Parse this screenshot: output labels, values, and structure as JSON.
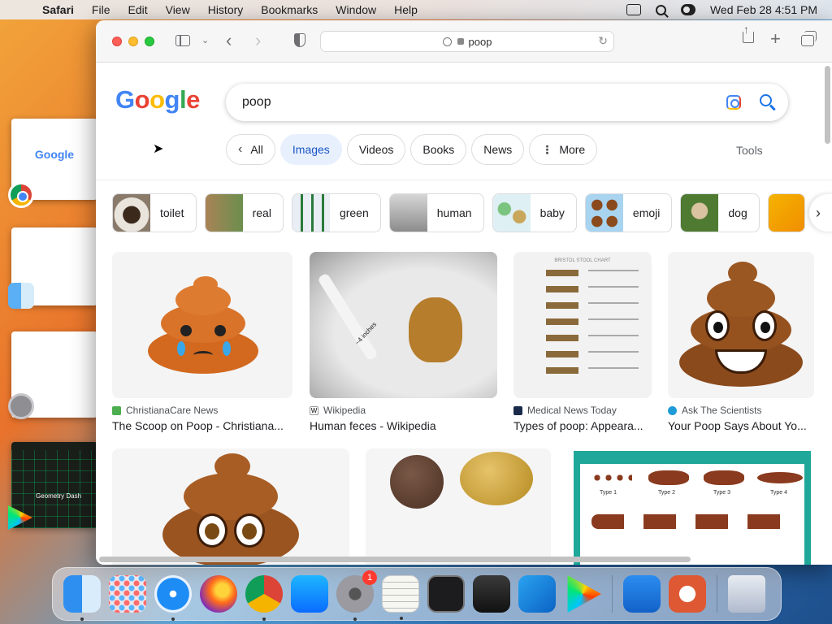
{
  "menubar": {
    "app": "Safari",
    "items": [
      "File",
      "Edit",
      "View",
      "History",
      "Bookmarks",
      "Window",
      "Help"
    ],
    "clock": "Wed Feb 28  4:51 PM"
  },
  "stage": {
    "thumb1_text": "Google",
    "thumb4_text": "Geometry Dash"
  },
  "browser": {
    "url": "poop"
  },
  "google": {
    "query": "poop",
    "tabs": [
      "All",
      "Images",
      "Videos",
      "Books",
      "News",
      "More"
    ],
    "active_tab": "Images",
    "tools": "Tools",
    "related": [
      "toilet",
      "real",
      "green",
      "human",
      "baby",
      "emoji",
      "dog"
    ],
    "results": [
      {
        "source": "ChristianaCare News",
        "title": "The Scoop on Poop - Christiana..."
      },
      {
        "source": "Wikipedia",
        "title": "Human feces - Wikipedia"
      },
      {
        "source": "Medical News Today",
        "title": "Types of poop: Appeara..."
      },
      {
        "source": "Ask The Scientists",
        "title": "Your Poop Says About Yo..."
      }
    ],
    "chart_labels": [
      "Type 1",
      "Type 2",
      "Type 3",
      "Type 4"
    ],
    "stool_chart_title": "BRISTOL STOOL CHART",
    "inch_label": "~4 inches"
  },
  "dock": {
    "badge": "1"
  },
  "colors": {
    "accent": "#1a73e8",
    "active_tab_bg": "#e8f0fe",
    "poop": "#8b4a1c"
  }
}
